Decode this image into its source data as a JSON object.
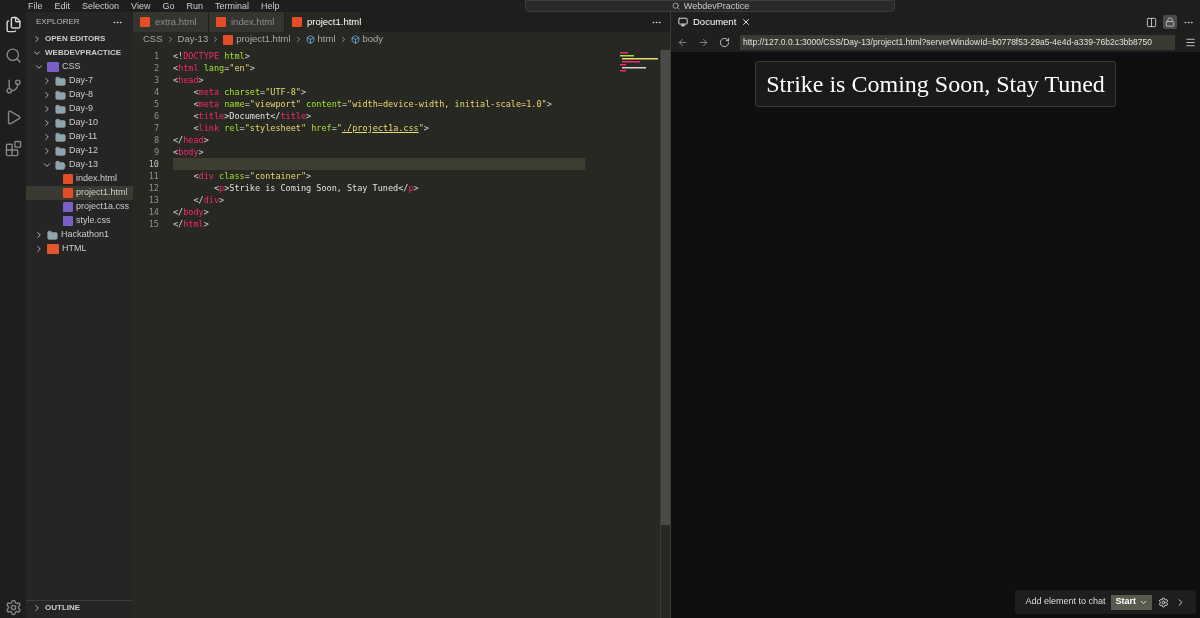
{
  "menu": [
    "File",
    "Edit",
    "Selection",
    "View",
    "Go",
    "Run",
    "Terminal",
    "Help"
  ],
  "title_search": "WebdevPractice",
  "sidebar": {
    "title": "EXPLORER",
    "sections": [
      {
        "label": "OPEN EDITORS",
        "expanded": false
      },
      {
        "label": "WEBDEVPRACTICE",
        "expanded": true
      }
    ],
    "tree": [
      {
        "name": "CSS",
        "kind": "css-folder",
        "expanded": true,
        "selected": false,
        "children": [
          {
            "name": "Day-7",
            "kind": "folder",
            "expanded": false,
            "selected": false
          },
          {
            "name": "Day-8",
            "kind": "folder",
            "expanded": false,
            "selected": false
          },
          {
            "name": "Day-9",
            "kind": "folder",
            "expanded": false,
            "selected": false
          },
          {
            "name": "Day-10",
            "kind": "folder",
            "expanded": false,
            "selected": false
          },
          {
            "name": "Day-11",
            "kind": "folder",
            "expanded": false,
            "selected": false
          },
          {
            "name": "Day-12",
            "kind": "folder",
            "expanded": false,
            "selected": false
          },
          {
            "name": "Day-13",
            "kind": "folder",
            "expanded": true,
            "selected": false,
            "children": [
              {
                "name": "index.html",
                "kind": "html",
                "selected": false
              },
              {
                "name": "project1.html",
                "kind": "html",
                "selected": true
              },
              {
                "name": "project1a.css",
                "kind": "css",
                "selected": false
              },
              {
                "name": "style.css",
                "kind": "css",
                "selected": false
              }
            ]
          }
        ]
      },
      {
        "name": "Hackathon1",
        "kind": "folder",
        "expanded": false,
        "selected": false
      },
      {
        "name": "HTML",
        "kind": "html-folder",
        "expanded": false,
        "selected": false
      }
    ],
    "footer": [
      {
        "label": "OUTLINE",
        "expanded": false
      }
    ]
  },
  "tabs": [
    {
      "label": "extra.html",
      "selected": false
    },
    {
      "label": "index.html",
      "selected": false
    },
    {
      "label": "project1.html",
      "selected": true
    }
  ],
  "breadcrumb": [
    {
      "label": "CSS",
      "kind": "text"
    },
    {
      "label": "Day-13",
      "kind": "text"
    },
    {
      "label": "project1.html",
      "kind": "html"
    },
    {
      "label": "html",
      "kind": "element"
    },
    {
      "label": "body",
      "kind": "element"
    }
  ],
  "code": [
    {
      "number": "1",
      "current": false,
      "tokens": [
        {
          "kind": "punct",
          "text": "<!"
        },
        {
          "kind": "tag",
          "text": "DOCTYPE"
        },
        {
          "kind": "attr",
          "text": " html"
        },
        {
          "kind": "punct",
          "text": ">"
        }
      ]
    },
    {
      "number": "2",
      "current": false,
      "tokens": [
        {
          "kind": "punct",
          "text": "<"
        },
        {
          "kind": "tag",
          "text": "html"
        },
        {
          "kind": "attr",
          "text": " lang"
        },
        {
          "kind": "punct",
          "text": "="
        },
        {
          "kind": "string",
          "text": "\"en\""
        },
        {
          "kind": "punct",
          "text": ">"
        }
      ]
    },
    {
      "number": "3",
      "current": false,
      "tokens": [
        {
          "kind": "punct",
          "text": "<"
        },
        {
          "kind": "tag",
          "text": "head"
        },
        {
          "kind": "punct",
          "text": ">"
        }
      ]
    },
    {
      "number": "4",
      "current": false,
      "tokens": [
        {
          "kind": "punct",
          "text": "    <"
        },
        {
          "kind": "tag",
          "text": "meta"
        },
        {
          "kind": "attr",
          "text": " charset"
        },
        {
          "kind": "punct",
          "text": "="
        },
        {
          "kind": "string",
          "text": "\"UTF-8\""
        },
        {
          "kind": "punct",
          "text": ">"
        }
      ]
    },
    {
      "number": "5",
      "current": false,
      "tokens": [
        {
          "kind": "punct",
          "text": "    <"
        },
        {
          "kind": "tag",
          "text": "meta"
        },
        {
          "kind": "attr",
          "text": " name"
        },
        {
          "kind": "punct",
          "text": "="
        },
        {
          "kind": "string",
          "text": "\"viewport\""
        },
        {
          "kind": "attr",
          "text": " content"
        },
        {
          "kind": "punct",
          "text": "="
        },
        {
          "kind": "string",
          "text": "\"width=device-width, initial-scale=1.0\""
        },
        {
          "kind": "punct",
          "text": ">"
        }
      ]
    },
    {
      "number": "6",
      "current": false,
      "tokens": [
        {
          "kind": "punct",
          "text": "    <"
        },
        {
          "kind": "tag",
          "text": "title"
        },
        {
          "kind": "text",
          "text": ">Document</"
        },
        {
          "kind": "tag",
          "text": "title"
        },
        {
          "kind": "punct",
          "text": ">"
        }
      ]
    },
    {
      "number": "7",
      "current": false,
      "tokens": [
        {
          "kind": "punct",
          "text": "    <"
        },
        {
          "kind": "tag",
          "text": "link"
        },
        {
          "kind": "attr",
          "text": " rel"
        },
        {
          "kind": "punct",
          "text": "="
        },
        {
          "kind": "string",
          "text": "\"stylesheet\""
        },
        {
          "kind": "attr",
          "text": " href"
        },
        {
          "kind": "punct",
          "text": "="
        },
        {
          "kind": "string",
          "text": "\""
        },
        {
          "kind": "link",
          "text": "./project1a.css"
        },
        {
          "kind": "string",
          "text": "\""
        },
        {
          "kind": "punct",
          "text": ">"
        }
      ]
    },
    {
      "number": "8",
      "current": false,
      "tokens": [
        {
          "kind": "punct",
          "text": "</"
        },
        {
          "kind": "tag",
          "text": "head"
        },
        {
          "kind": "punct",
          "text": ">"
        }
      ]
    },
    {
      "number": "9",
      "current": false,
      "tokens": [
        {
          "kind": "punct",
          "text": "<"
        },
        {
          "kind": "tag",
          "text": "body"
        },
        {
          "kind": "punct",
          "text": ">"
        }
      ]
    },
    {
      "number": "10",
      "current": true
    },
    {
      "number": "11",
      "current": false,
      "tokens": [
        {
          "kind": "punct",
          "text": "    <"
        },
        {
          "kind": "tag",
          "text": "div"
        },
        {
          "kind": "attr",
          "text": " class"
        },
        {
          "kind": "punct",
          "text": "="
        },
        {
          "kind": "string",
          "text": "\"container\""
        },
        {
          "kind": "punct",
          "text": ">"
        }
      ]
    },
    {
      "number": "12",
      "current": false,
      "tokens": [
        {
          "kind": "punct",
          "text": "        <"
        },
        {
          "kind": "tag",
          "text": "p"
        },
        {
          "kind": "text",
          "text": ">Strike is Coming Soon, Stay Tuned</"
        },
        {
          "kind": "tag",
          "text": "p"
        },
        {
          "kind": "punct",
          "text": ">"
        }
      ]
    },
    {
      "number": "13",
      "current": false,
      "tokens": [
        {
          "kind": "punct",
          "text": "    </"
        },
        {
          "kind": "tag",
          "text": "div"
        },
        {
          "kind": "punct",
          "text": ">"
        }
      ]
    },
    {
      "number": "14",
      "current": false,
      "tokens": [
        {
          "kind": "punct",
          "text": "</"
        },
        {
          "kind": "tag",
          "text": "body"
        },
        {
          "kind": "punct",
          "text": ">"
        }
      ]
    },
    {
      "number": "15",
      "current": false,
      "tokens": [
        {
          "kind": "punct",
          "text": "</"
        },
        {
          "kind": "tag",
          "text": "html"
        },
        {
          "kind": "punct",
          "text": ">"
        }
      ]
    }
  ],
  "preview": {
    "tab": {
      "label": "Document",
      "selected": true
    },
    "url": "http://127.0.0.1:3000/CSS/Day-13/project1.html?serverWindowId=b0778f53-29a5-4e4d-a339-76b2c3bb8750",
    "heading": "Strike is Coming Soon, Stay Tuned",
    "chat_bar": {
      "label": "Add element to chat",
      "button": "Start"
    }
  }
}
